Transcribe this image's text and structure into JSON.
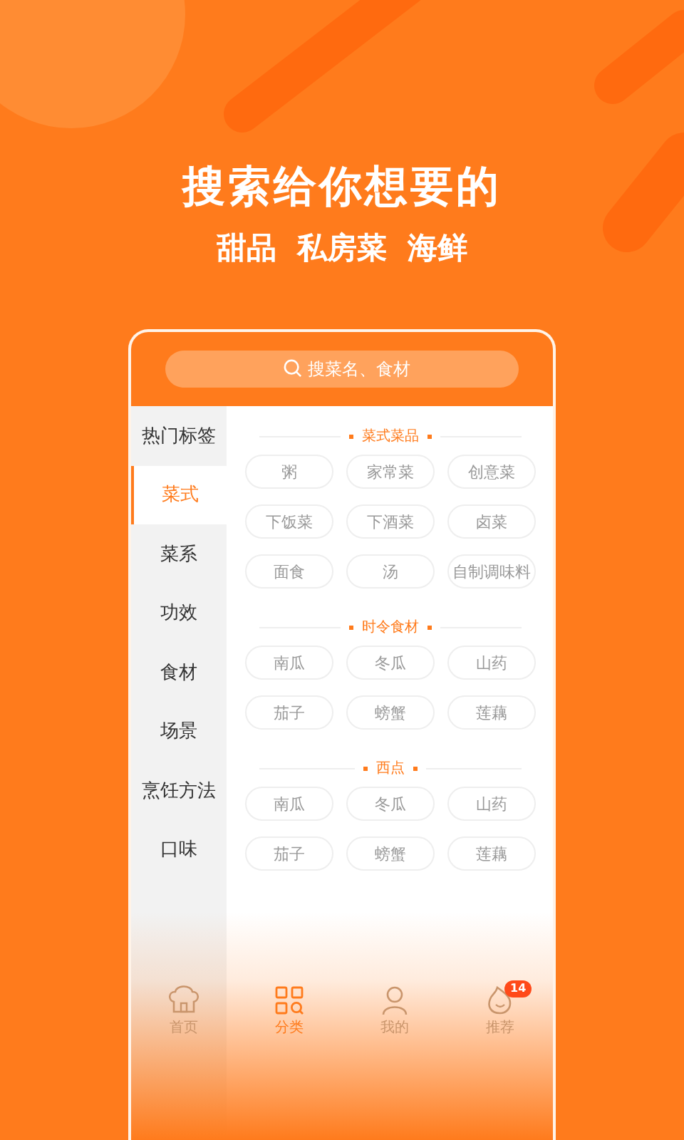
{
  "headline": "搜索给你想要的",
  "subheadline": "甜品  私房菜  海鲜",
  "search": {
    "placeholder": "搜菜名、食材"
  },
  "sidebar": {
    "items": [
      {
        "label": "热门标签",
        "selected": false
      },
      {
        "label": "菜式",
        "selected": true
      },
      {
        "label": "菜系",
        "selected": false
      },
      {
        "label": "功效",
        "selected": false
      },
      {
        "label": "食材",
        "selected": false
      },
      {
        "label": "场景",
        "selected": false
      },
      {
        "label": "烹饪方法",
        "selected": false
      },
      {
        "label": "口味",
        "selected": false
      }
    ]
  },
  "sections": [
    {
      "title": "菜式菜品",
      "chips": [
        "粥",
        "家常菜",
        "创意菜",
        "下饭菜",
        "下酒菜",
        "卤菜",
        "面食",
        "汤",
        "自制调味料"
      ]
    },
    {
      "title": "时令食材",
      "chips": [
        "南瓜",
        "冬瓜",
        "山药",
        "茄子",
        "螃蟹",
        "莲藕"
      ]
    },
    {
      "title": "西点",
      "chips": [
        "南瓜",
        "冬瓜",
        "山药",
        "茄子",
        "螃蟹",
        "莲藕"
      ]
    }
  ],
  "tabs": [
    {
      "label": "首页",
      "kind": "home",
      "selected": false
    },
    {
      "label": "分类",
      "kind": "category",
      "selected": true
    },
    {
      "label": "我的",
      "kind": "profile",
      "selected": false
    },
    {
      "label": "推荐",
      "kind": "recommend",
      "selected": false,
      "badge": "14"
    }
  ]
}
